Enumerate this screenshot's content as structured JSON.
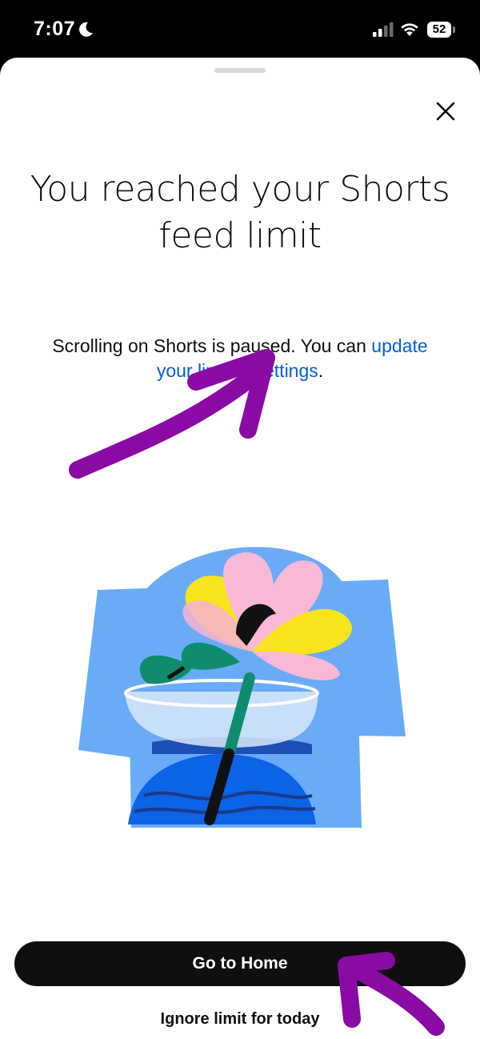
{
  "status_bar": {
    "time": "7:07",
    "battery_level": "52",
    "icons": [
      "moon-icon",
      "signal-icon",
      "wifi-icon",
      "battery-icon"
    ]
  },
  "sheet": {
    "close_icon": "close-icon",
    "title": "You reached your Shorts feed limit",
    "message_prefix": "Scrolling on Shorts is paused. You can ",
    "message_link": "update your limit in settings",
    "message_suffix": ".",
    "illustration": "flower-in-bowl-illustration",
    "primary_button": "Go to Home",
    "secondary_link": "Ignore limit for today"
  },
  "annotations": {
    "color": "#8b0aa5",
    "marks": [
      "arrow-pointing-to-settings-link",
      "arrow-pointing-to-ignore-link"
    ]
  },
  "colors": {
    "link": "#065fd4",
    "button_bg": "#0f0f0f",
    "text": "#0f0f0f"
  }
}
